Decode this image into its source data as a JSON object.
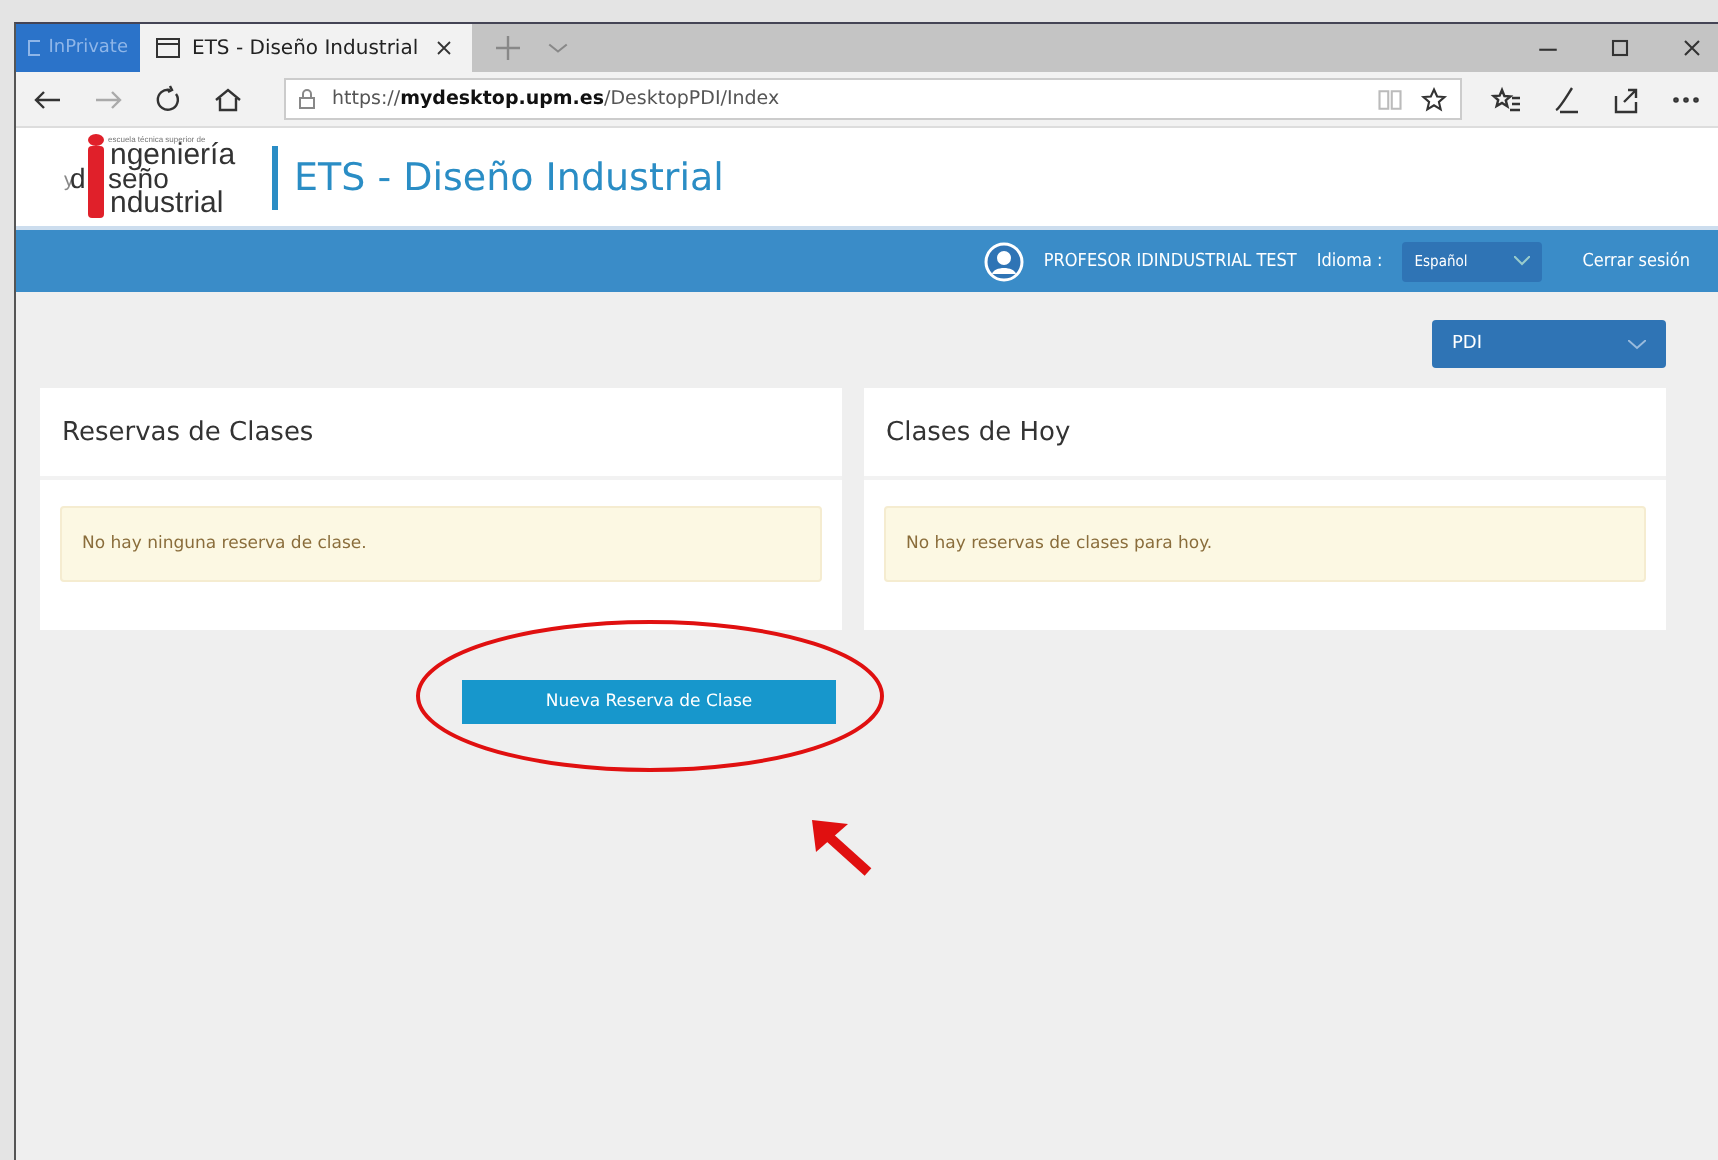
{
  "browser": {
    "private_label": "InPrivate",
    "tabs": [
      {
        "title": "ETS - Diseño Industrial",
        "selected": true
      }
    ],
    "url": {
      "scheme": "https://",
      "host": "mydesktop.upm.es",
      "path": "/DesktopPDI/Index"
    }
  },
  "header": {
    "logo": {
      "tagline": "escuela técnica superior de",
      "lines": [
        "ngeniería",
        "y",
        "d",
        "seño",
        "ndustrial"
      ]
    },
    "title": "ETS - Diseño Industrial"
  },
  "navbar": {
    "user": "PROFESOR IDINDUSTRIAL TEST",
    "language_label": "Idioma :",
    "language": "Español",
    "logout": "Cerrar sesión"
  },
  "role_select": {
    "value": "PDI"
  },
  "panels": [
    {
      "title": "Reservas de Clases",
      "message": "No hay ninguna reserva de clase."
    },
    {
      "title": "Clases de Hoy",
      "message": "No hay reservas de clases para hoy."
    }
  ],
  "new_button": "Nueva Reserva de Clase"
}
